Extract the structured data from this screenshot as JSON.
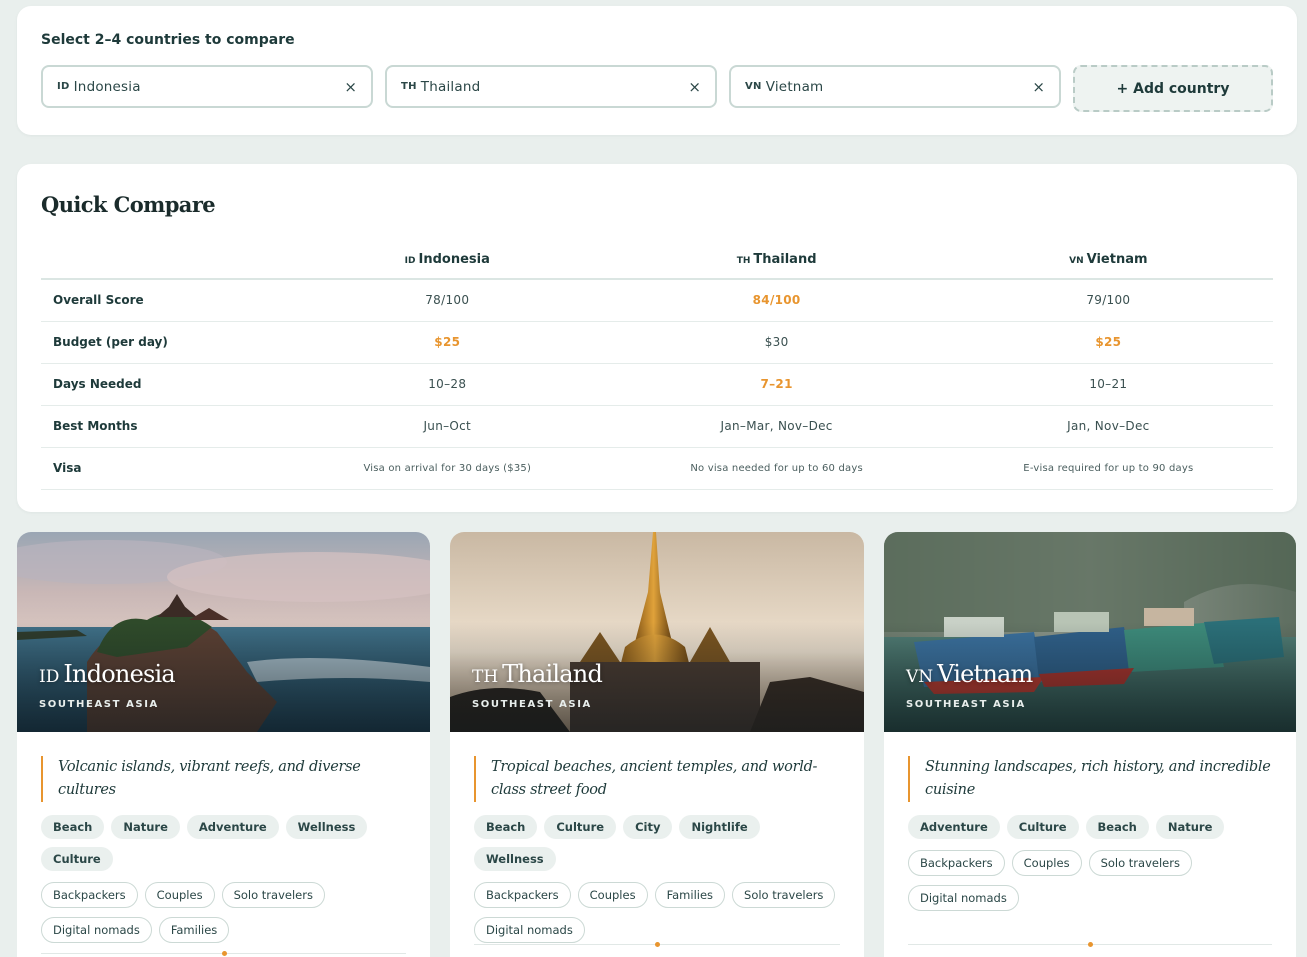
{
  "selector": {
    "title": "Select 2–4 countries to compare",
    "countries": [
      {
        "code": "ID",
        "name": "Indonesia",
        "remove": "×"
      },
      {
        "code": "TH",
        "name": "Thailand",
        "remove": "×"
      },
      {
        "code": "VN",
        "name": "Vietnam",
        "remove": "×"
      }
    ],
    "add_label": "+ Add country"
  },
  "compare": {
    "title": "Quick Compare",
    "headers": [
      {
        "code": "ID",
        "name": "Indonesia"
      },
      {
        "code": "TH",
        "name": "Thailand"
      },
      {
        "code": "VN",
        "name": "Vietnam"
      }
    ],
    "rows": [
      {
        "label": "Overall Score",
        "values": [
          "78/100",
          "84/100",
          "79/100"
        ],
        "best": [
          false,
          true,
          false
        ]
      },
      {
        "label": "Budget (per day)",
        "values": [
          "$25",
          "$30",
          "$25"
        ],
        "best": [
          true,
          false,
          true
        ]
      },
      {
        "label": "Days Needed",
        "values": [
          "10–28",
          "7–21",
          "10–21"
        ],
        "best": [
          false,
          true,
          false
        ]
      },
      {
        "label": "Best Months",
        "values": [
          "Jun–Oct",
          "Jan–Mar, Nov–Dec",
          "Jan, Nov–Dec"
        ],
        "best": [
          false,
          false,
          false
        ]
      },
      {
        "label": "Visa",
        "values": [
          "Visa on arrival for 30 days ($35)",
          "No visa needed for up to 60 days",
          "E-visa required for up to 90 days"
        ],
        "best": [
          false,
          false,
          false
        ]
      }
    ]
  },
  "cards": [
    {
      "code": "ID",
      "name": "Indonesia",
      "region": "SOUTHEAST ASIA",
      "tagline": "Volcanic islands, vibrant reefs, and diverse cultures",
      "tags": [
        "Beach",
        "Nature",
        "Adventure",
        "Wellness",
        "Culture"
      ],
      "audiences": [
        "Backpackers",
        "Couples",
        "Solo travelers",
        "Digital nomads",
        "Families"
      ]
    },
    {
      "code": "TH",
      "name": "Thailand",
      "region": "SOUTHEAST ASIA",
      "tagline": "Tropical beaches, ancient temples, and world-class street food",
      "tags": [
        "Beach",
        "Culture",
        "City",
        "Nightlife",
        "Wellness"
      ],
      "audiences": [
        "Backpackers",
        "Couples",
        "Families",
        "Solo travelers",
        "Digital nomads"
      ]
    },
    {
      "code": "VN",
      "name": "Vietnam",
      "region": "SOUTHEAST ASIA",
      "tagline": "Stunning landscapes, rich history, and incredible cuisine",
      "tags": [
        "Adventure",
        "Culture",
        "Beach",
        "Nature"
      ],
      "audiences": [
        "Backpackers",
        "Couples",
        "Solo travelers",
        "Digital nomads"
      ]
    }
  ],
  "colors": {
    "accent": "#e8952f",
    "primary_text": "#1e3a3a",
    "background": "#e9efed"
  }
}
